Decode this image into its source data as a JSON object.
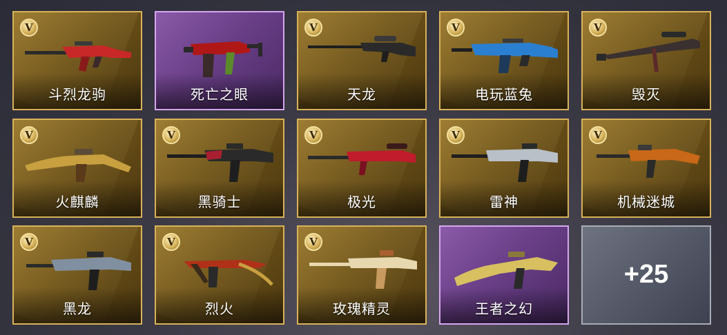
{
  "badge_letter": "V",
  "items": [
    {
      "name": "斗烈龙驹",
      "rarity": "gold",
      "accent": "#c82828",
      "badge": true
    },
    {
      "name": "死亡之眼",
      "rarity": "purple",
      "accent": "#b01818",
      "badge": false
    },
    {
      "name": "天龙",
      "rarity": "gold",
      "accent": "#2a2a2a",
      "badge": true
    },
    {
      "name": "电玩蓝兔",
      "rarity": "gold",
      "accent": "#2a7fd0",
      "badge": true
    },
    {
      "name": "毁灭",
      "rarity": "gold",
      "accent": "#3a3030",
      "badge": true
    },
    {
      "name": "火麒麟",
      "rarity": "gold",
      "accent": "#c8a040",
      "badge": true
    },
    {
      "name": "黑骑士",
      "rarity": "gold",
      "accent": "#a82030",
      "badge": true
    },
    {
      "name": "极光",
      "rarity": "gold",
      "accent": "#c01c2c",
      "badge": true
    },
    {
      "name": "雷神",
      "rarity": "gold",
      "accent": "#b8c0c8",
      "badge": true
    },
    {
      "name": "机械迷城",
      "rarity": "gold",
      "accent": "#c86818",
      "badge": true
    },
    {
      "name": "黑龙",
      "rarity": "gold",
      "accent": "#8090a0",
      "badge": true
    },
    {
      "name": "烈火",
      "rarity": "gold",
      "accent": "#b03018",
      "badge": true
    },
    {
      "name": "玫瑰精灵",
      "rarity": "gold",
      "accent": "#e8d8b0",
      "badge": true
    },
    {
      "name": "王者之幻",
      "rarity": "purple",
      "accent": "#d8c060",
      "badge": false
    }
  ],
  "more": {
    "label": "+25"
  }
}
